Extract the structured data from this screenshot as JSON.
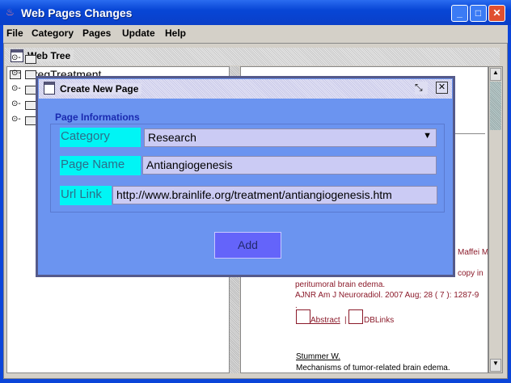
{
  "window": {
    "title": "Web Pages Changes",
    "minimize": "_",
    "maximize": "□",
    "close": "✕"
  },
  "menu": [
    "File",
    "Category",
    "Pages",
    "Update",
    "Help"
  ],
  "web_tree": {
    "title": "Web Tree",
    "root": "GregTreatment",
    "child_count": 5
  },
  "right_panel": {
    "lines": [
      "Maffei M",
      "copy in",
      "peritumoral brain edema.",
      "AJNR Am J Neuroradiol. 2007 Aug; 28 ( 7 ): 1287-9",
      "."
    ],
    "abstract_link": "Abstract",
    "separator": "|",
    "dblinks_link": "DBLinks",
    "author_link": "Stummer W.",
    "article_title": "Mechanisms of tumor-related brain edema."
  },
  "dialog": {
    "title": "Create New Page",
    "section": "Page Informations",
    "category_label": "Category",
    "category_value": "Research",
    "page_name_label": "Page Name",
    "page_name_value": "Antiangiogenesis",
    "url_label": "Url Link",
    "url_value": "http://www.brainlife.org/treatment/antiangiogenesis.htm",
    "add_label": "Add"
  }
}
